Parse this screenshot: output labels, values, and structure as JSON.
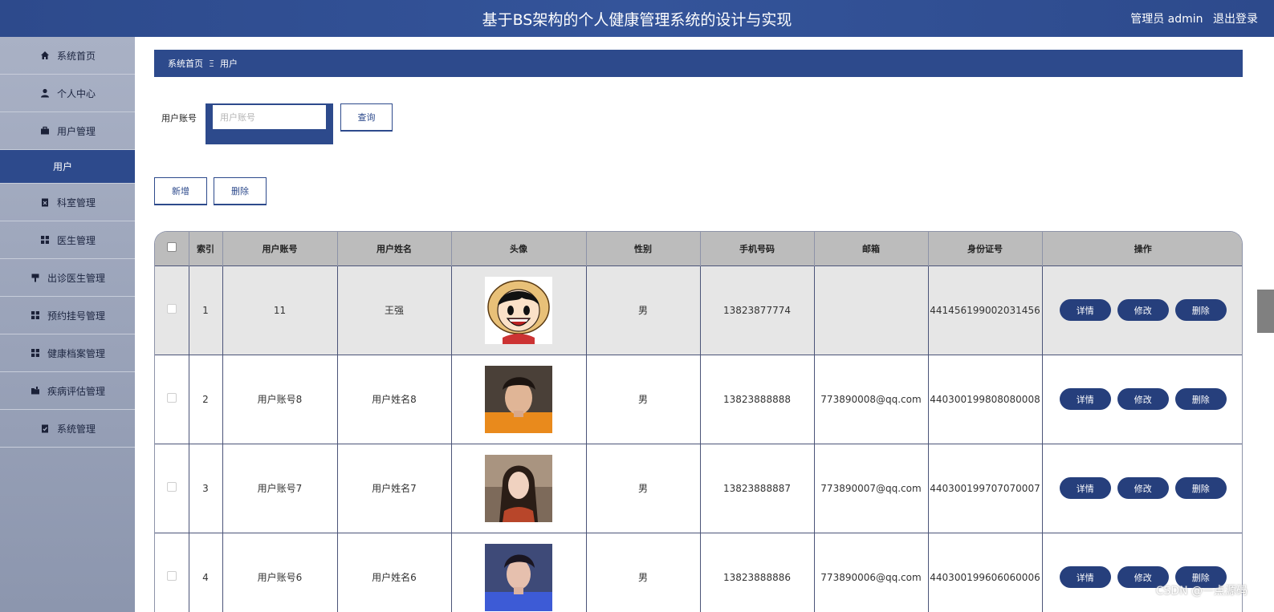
{
  "header": {
    "title": "基于BS架构的个人健康管理系统的设计与实现",
    "user_label": "管理员 admin",
    "logout": "退出登录"
  },
  "sidebar": {
    "items": [
      {
        "label": "系统首页",
        "icon": "home-icon"
      },
      {
        "label": "个人中心",
        "icon": "person-icon"
      },
      {
        "label": "用户管理",
        "icon": "briefcase-icon"
      },
      {
        "label": "用户",
        "icon": ""
      },
      {
        "label": "科室管理",
        "icon": "clipboard-x-icon"
      },
      {
        "label": "医生管理",
        "icon": "grid-icon"
      },
      {
        "label": "出诊医生管理",
        "icon": "sign-icon"
      },
      {
        "label": "预约挂号管理",
        "icon": "grid-icon"
      },
      {
        "label": "健康档案管理",
        "icon": "grid-icon"
      },
      {
        "label": "疾病评估管理",
        "icon": "folder-icon"
      },
      {
        "label": "系统管理",
        "icon": "clipboard-check-icon"
      }
    ],
    "active_index": 3
  },
  "breadcrumb": {
    "home": "系统首页",
    "separator": "Ξ",
    "current": "用户"
  },
  "search": {
    "label": "用户账号",
    "placeholder": "用户账号",
    "value": "",
    "query_button": "查询"
  },
  "actions": {
    "add": "新增",
    "delete": "删除"
  },
  "table": {
    "headers": [
      "索引",
      "用户账号",
      "用户姓名",
      "头像",
      "性别",
      "手机号码",
      "邮箱",
      "身份证号",
      "操作"
    ],
    "rows": [
      {
        "index": "1",
        "account": "11",
        "name": "王强",
        "avatar": "cartoon-avatar",
        "gender": "男",
        "phone": "13823877774",
        "email": "",
        "id_card": "441456199002031456"
      },
      {
        "index": "2",
        "account": "用户账号8",
        "name": "用户姓名8",
        "avatar": "photo-avatar",
        "gender": "男",
        "phone": "13823888888",
        "email": "773890008@qq.com",
        "id_card": "440300199808080008"
      },
      {
        "index": "3",
        "account": "用户账号7",
        "name": "用户姓名7",
        "avatar": "photo-avatar",
        "gender": "男",
        "phone": "13823888887",
        "email": "773890007@qq.com",
        "id_card": "440300199707070007"
      },
      {
        "index": "4",
        "account": "用户账号6",
        "name": "用户姓名6",
        "avatar": "photo-avatar",
        "gender": "男",
        "phone": "13823888886",
        "email": "773890006@qq.com",
        "id_card": "440300199606060006"
      }
    ],
    "row_actions": {
      "detail": "详情",
      "edit": "修改",
      "delete": "删除"
    }
  },
  "watermark": "CSDN @一点源码",
  "colors": {
    "primary": "#2d4a8c",
    "button": "#263f7c",
    "sidebar": "#a9b1c5"
  }
}
